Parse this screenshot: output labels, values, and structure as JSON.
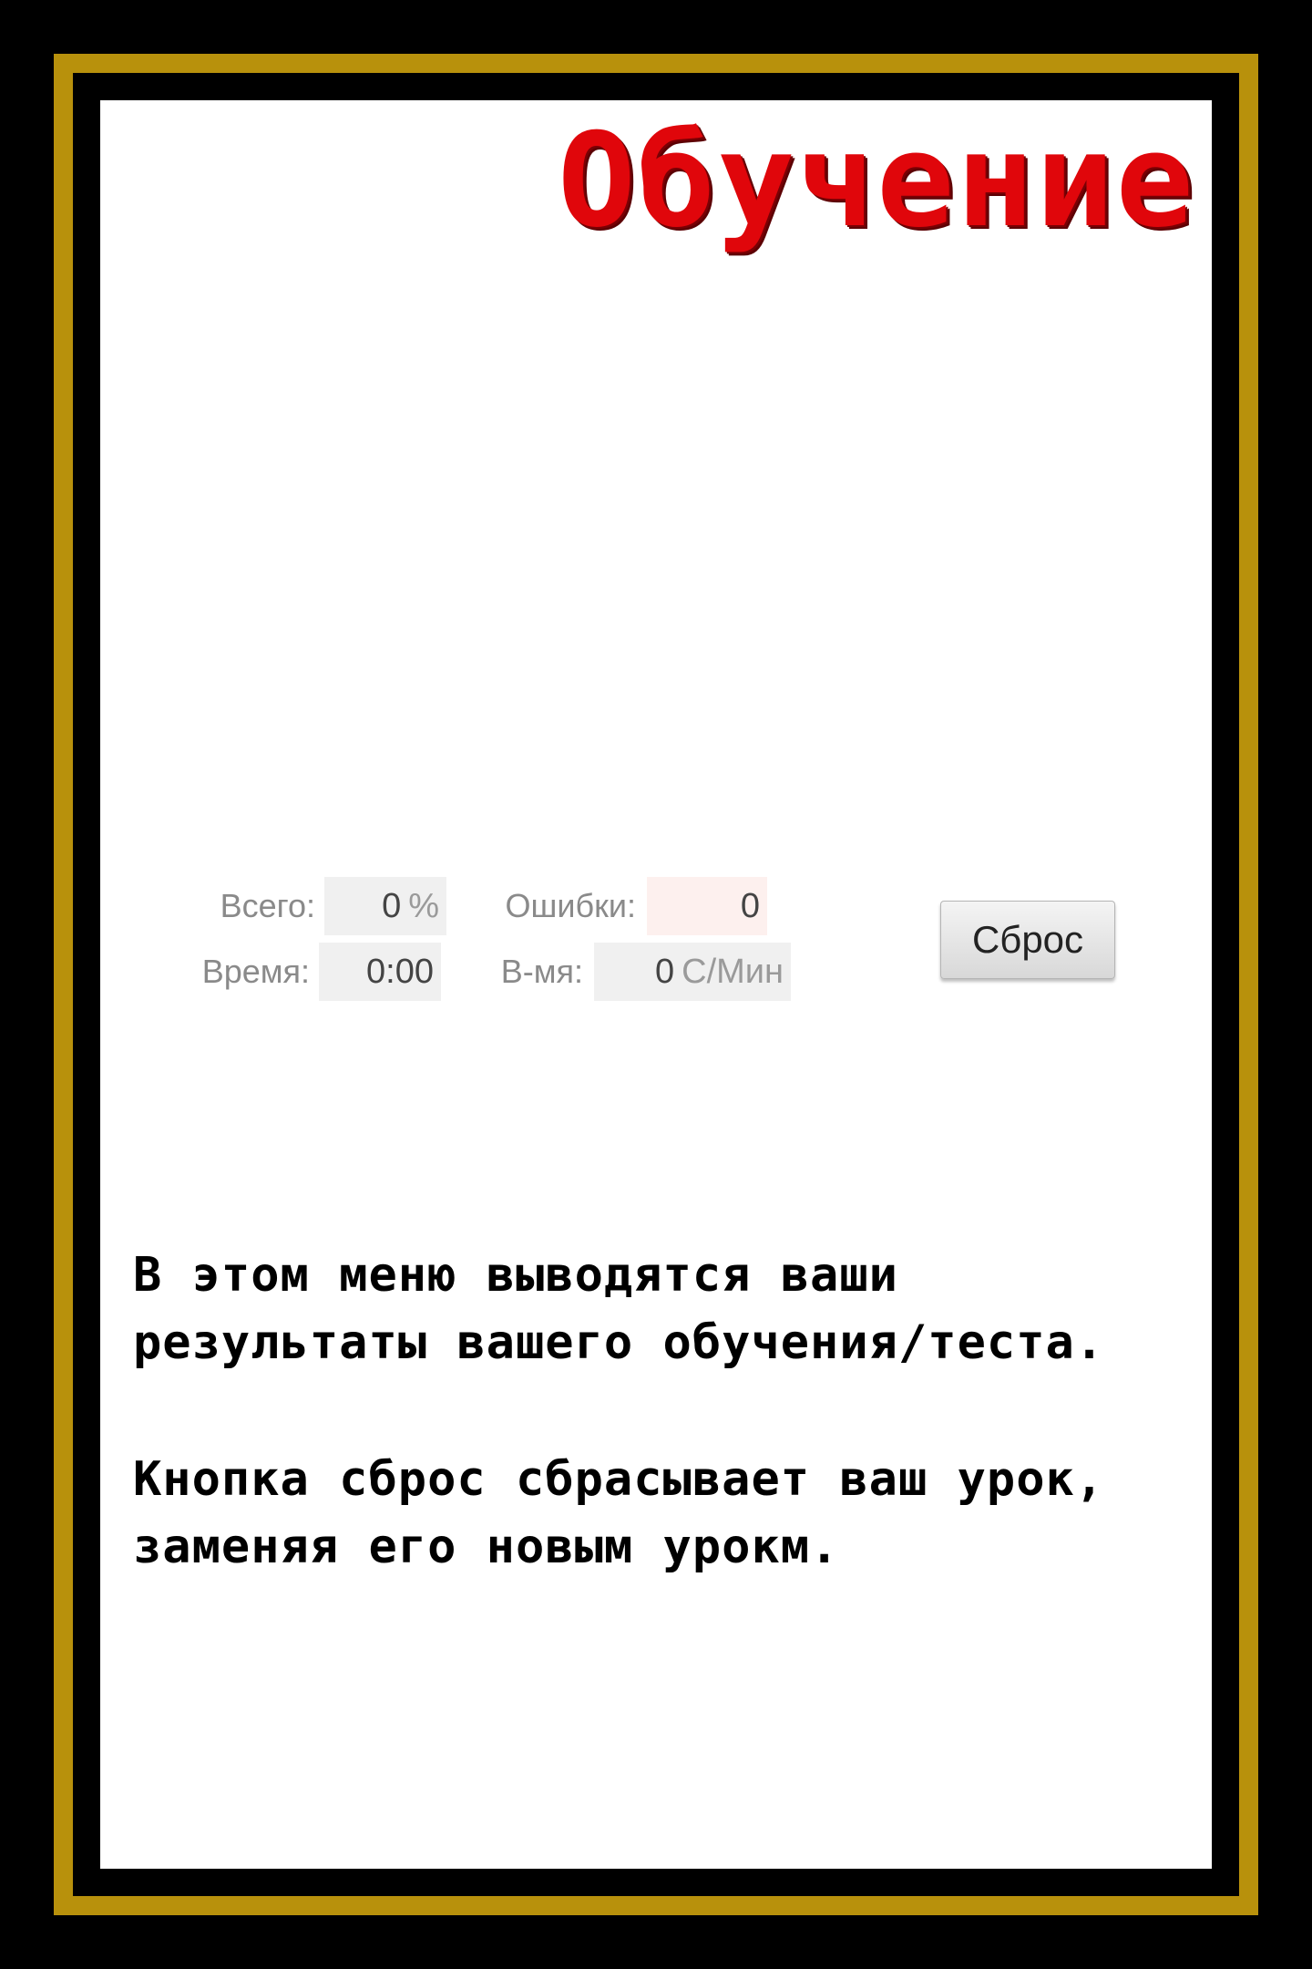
{
  "title": "Обучение",
  "stats": {
    "total_label": "Всего:",
    "total_value": "0",
    "total_unit": "%",
    "errors_label": "Ошибки:",
    "errors_value": "0",
    "time_label": "Время:",
    "time_value": "0:00",
    "speed_label": "В-мя:",
    "speed_value": "0",
    "speed_unit": "С/Мин"
  },
  "reset_label": "Сброс",
  "description": {
    "paragraph1_line1": "В этом меню выводятся ваши",
    "paragraph1_line2": "результаты вашего обучения/теста.",
    "paragraph2_line1": "Кнопка сброс сбрасывает ваш урок,",
    "paragraph2_line2": "заменяя его новым урокм."
  },
  "colors": {
    "frame_gold": "#b8910c",
    "title_red": "#e0060b",
    "background": "#000000",
    "panel": "#ffffff"
  }
}
